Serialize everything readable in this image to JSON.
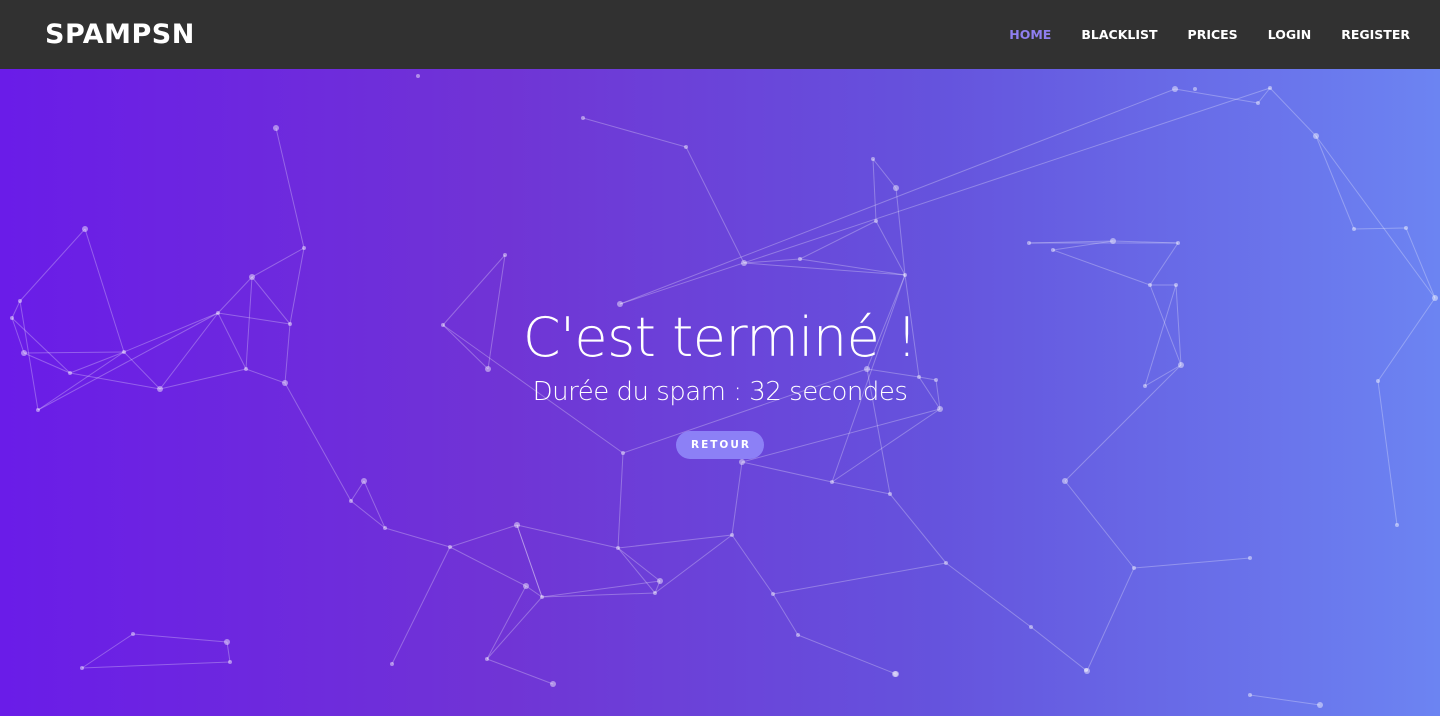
{
  "brand": {
    "name": "SPAMPSN"
  },
  "nav": {
    "items": [
      {
        "label": "HOME",
        "active": true
      },
      {
        "label": "BLACKLIST",
        "active": false
      },
      {
        "label": "PRICES",
        "active": false
      },
      {
        "label": "LOGIN",
        "active": false
      },
      {
        "label": "REGISTER",
        "active": false
      }
    ]
  },
  "hero": {
    "title": "C'est terminé !",
    "subtitle": "Durée du spam : 32 secondes",
    "button_label": "RETOUR"
  },
  "colors": {
    "navbar_bg": "#313131",
    "nav_active": "#8f7ff0",
    "gradient_start": "#6a1ce8",
    "gradient_end": "#6c84f2",
    "button_bg": "#8c80f6"
  }
}
